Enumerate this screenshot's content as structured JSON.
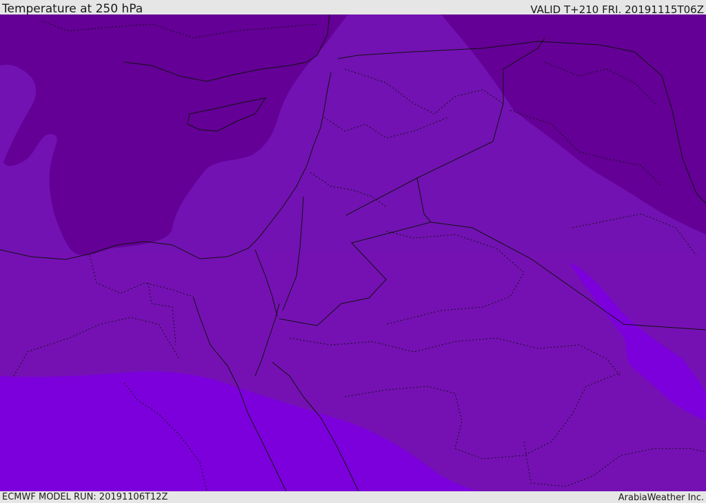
{
  "header": {
    "title": "Temperature at 250 hPa",
    "valid": "VALID T+210 FRI. 20191115T06Z"
  },
  "footer": {
    "model_run": "ECMWF MODEL RUN: 20191106T12Z",
    "credit": "ArabiaWeather Inc."
  },
  "colors": {
    "band_dark": "#640096",
    "band_mid": "#7212b2",
    "band_low": "#7910b5",
    "band_bright": "#7c00dc",
    "border_line": "#111111",
    "header_bg": "#e6e6e6"
  }
}
